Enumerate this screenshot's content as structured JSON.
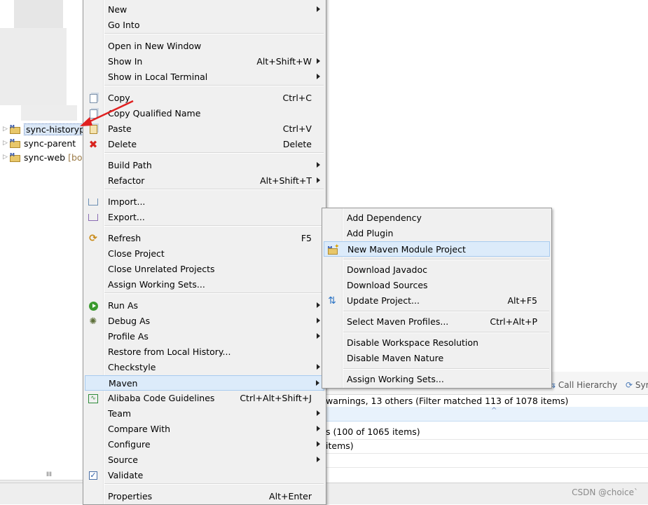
{
  "explorer": {
    "projects": [
      {
        "label": "sync-historypr",
        "decoration": "",
        "selected": true
      },
      {
        "label": "sync-parent",
        "decoration": "",
        "selected": false
      },
      {
        "label": "sync-web",
        "decoration": "[boc",
        "selected": false
      }
    ],
    "scroll_grip": "III"
  },
  "context_menu": {
    "items": [
      {
        "label": "New",
        "accel": "",
        "submenu": true,
        "icon": ""
      },
      {
        "label": "Go Into",
        "accel": "",
        "submenu": false,
        "icon": ""
      },
      {
        "label": "Open in New Window",
        "accel": "",
        "submenu": false,
        "icon": ""
      },
      {
        "label": "Show In",
        "accel": "Alt+Shift+W",
        "submenu": true,
        "icon": ""
      },
      {
        "label": "Show in Local Terminal",
        "accel": "",
        "submenu": true,
        "icon": ""
      },
      {
        "label": "Copy",
        "accel": "Ctrl+C",
        "submenu": false,
        "icon": "copy-icon"
      },
      {
        "label": "Copy Qualified Name",
        "accel": "",
        "submenu": false,
        "icon": "copy-qualified-icon"
      },
      {
        "label": "Paste",
        "accel": "Ctrl+V",
        "submenu": false,
        "icon": "paste-icon"
      },
      {
        "label": "Delete",
        "accel": "Delete",
        "submenu": false,
        "icon": "delete-icon"
      },
      {
        "label": "Build Path",
        "accel": "",
        "submenu": true,
        "icon": ""
      },
      {
        "label": "Refactor",
        "accel": "Alt+Shift+T",
        "submenu": true,
        "icon": ""
      },
      {
        "label": "Import...",
        "accel": "",
        "submenu": false,
        "icon": "import-icon"
      },
      {
        "label": "Export...",
        "accel": "",
        "submenu": false,
        "icon": "export-icon"
      },
      {
        "label": "Refresh",
        "accel": "F5",
        "submenu": false,
        "icon": "refresh-icon"
      },
      {
        "label": "Close Project",
        "accel": "",
        "submenu": false,
        "icon": ""
      },
      {
        "label": "Close Unrelated Projects",
        "accel": "",
        "submenu": false,
        "icon": ""
      },
      {
        "label": "Assign Working Sets...",
        "accel": "",
        "submenu": false,
        "icon": ""
      },
      {
        "label": "Run As",
        "accel": "",
        "submenu": true,
        "icon": "run-icon"
      },
      {
        "label": "Debug As",
        "accel": "",
        "submenu": true,
        "icon": "bug-icon"
      },
      {
        "label": "Profile As",
        "accel": "",
        "submenu": true,
        "icon": ""
      },
      {
        "label": "Restore from Local History...",
        "accel": "",
        "submenu": false,
        "icon": ""
      },
      {
        "label": "Checkstyle",
        "accel": "",
        "submenu": true,
        "icon": ""
      },
      {
        "label": "Maven",
        "accel": "",
        "submenu": true,
        "icon": ""
      },
      {
        "label": "Alibaba Code Guidelines",
        "accel": "Ctrl+Alt+Shift+J",
        "submenu": false,
        "icon": "code-guidelines-icon"
      },
      {
        "label": "Team",
        "accel": "",
        "submenu": true,
        "icon": ""
      },
      {
        "label": "Compare With",
        "accel": "",
        "submenu": true,
        "icon": ""
      },
      {
        "label": "Configure",
        "accel": "",
        "submenu": true,
        "icon": ""
      },
      {
        "label": "Source",
        "accel": "",
        "submenu": true,
        "icon": ""
      },
      {
        "label": "Validate",
        "accel": "",
        "submenu": false,
        "icon": "checkbox-icon"
      },
      {
        "label": "Properties",
        "accel": "Alt+Enter",
        "submenu": false,
        "icon": ""
      }
    ]
  },
  "maven_submenu": {
    "items": [
      {
        "label": "Add Dependency",
        "accel": "",
        "icon": ""
      },
      {
        "label": "Add Plugin",
        "accel": "",
        "icon": ""
      },
      {
        "label": "New Maven Module Project",
        "accel": "",
        "icon": "maven-module-icon"
      },
      {
        "label": "Download Javadoc",
        "accel": "",
        "icon": ""
      },
      {
        "label": "Download Sources",
        "accel": "",
        "icon": ""
      },
      {
        "label": "Update Project...",
        "accel": "Alt+F5",
        "icon": "update-icon"
      },
      {
        "label": "Select Maven Profiles...",
        "accel": "Ctrl+Alt+P",
        "icon": ""
      },
      {
        "label": "Disable Workspace Resolution",
        "accel": "",
        "icon": ""
      },
      {
        "label": "Disable Maven Nature",
        "accel": "",
        "icon": ""
      },
      {
        "label": "Assign Working Sets...",
        "accel": "",
        "icon": ""
      }
    ]
  },
  "bottom_panel": {
    "tabs": [
      "Call Hierarchy",
      "Syr"
    ],
    "status": "warnings, 13 others (Filter matched 113 of 1078 items)",
    "rows": [
      "s (100 of 1065 items)",
      "items)"
    ]
  },
  "watermark": "CSDN @choice`"
}
